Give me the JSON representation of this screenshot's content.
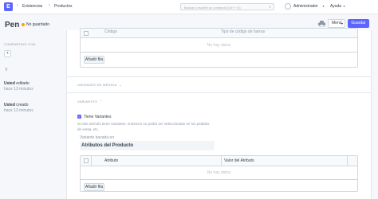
{
  "topbar": {
    "logo": "E",
    "breadcrumbs": [
      "Existencias",
      "Productos"
    ],
    "search_placeholder": "Buscar o escribir un comando (Ctrl + G)",
    "user_label": "Administrador",
    "help_label": "Ayuda"
  },
  "header": {
    "title": "Pen",
    "status": "No guardado",
    "menu_label": "Menú",
    "save_label": "Guardar"
  },
  "sidebar": {
    "shared_with_label": "COMPARTIDO CON",
    "add_share_label": "+",
    "edited_by": "Usted",
    "edited_action": "editado",
    "edited_time": "hace 13 minutos",
    "created_by": "Usted",
    "created_action": "creado",
    "created_time": "hace 13 minutos"
  },
  "top_grid": {
    "col_codigo": "Código",
    "col_tipo": "Tipo de código de barras",
    "empty": "No hay datos",
    "add_row": "Añadir fila"
  },
  "sections": {
    "unidades": "UNIDADES DE MEDIDA",
    "variantes": "VARIANTES"
  },
  "variants": {
    "checkbox_label": "Tiene Variantes",
    "help_text": "Si este artículo tiene variantes, entonces no podrá ser seleccionado en los pedidos de venta, etc.",
    "based_on_label": "Variante basada en",
    "based_on_value": "Atributos del Producto"
  },
  "attr_grid": {
    "col_atributo": "Atributo",
    "col_valor": "Valor del Atributo",
    "empty": "No hay datos",
    "add_row": "Añadir fila"
  },
  "colors": {
    "primary": "#5e64ff",
    "status_dot": "#ffa00a",
    "background": "#f5f7fa"
  }
}
